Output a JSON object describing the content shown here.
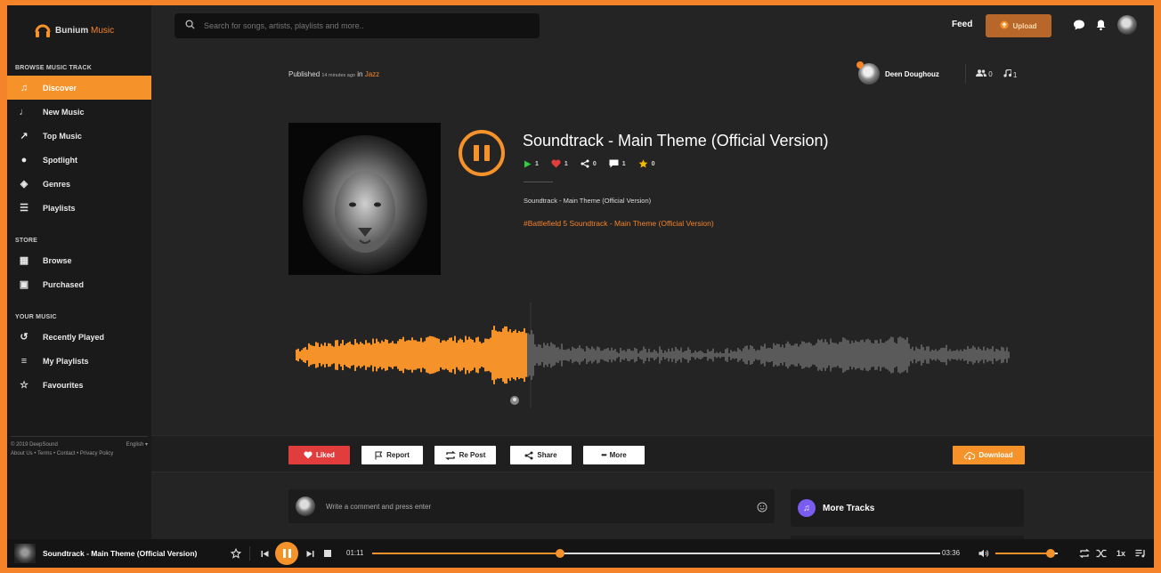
{
  "brand": {
    "name_part1": "Bunium",
    "name_part2": "Music",
    "accent": "#f5932a",
    "frame_color": "#f5832a"
  },
  "header": {
    "search_placeholder": "Search for songs, artists, playlists and more..",
    "feed_label": "Feed",
    "upload_label": "Upload",
    "icons": [
      "chat-icon",
      "bell-icon",
      "user-avatar"
    ]
  },
  "sidebar": {
    "sections": [
      {
        "title": "BROWSE MUSIC TRACK",
        "items": [
          {
            "label": "Discover",
            "icon": "music-notes-icon",
            "active": true
          },
          {
            "label": "New Music",
            "icon": "music-note-icon"
          },
          {
            "label": "Top Music",
            "icon": "chart-line-icon"
          },
          {
            "label": "Spotlight",
            "icon": "drop-icon"
          },
          {
            "label": "Genres",
            "icon": "layers-icon"
          },
          {
            "label": "Playlists",
            "icon": "playlist-icon"
          }
        ]
      },
      {
        "title": "STORE",
        "items": [
          {
            "label": "Browse",
            "icon": "store-icon"
          },
          {
            "label": "Purchased",
            "icon": "bag-icon"
          }
        ]
      },
      {
        "title": "YOUR MUSIC",
        "items": [
          {
            "label": "Recently Played",
            "icon": "history-icon"
          },
          {
            "label": "My Playlists",
            "icon": "my-playlist-icon"
          },
          {
            "label": "Favourites",
            "icon": "star-icon"
          }
        ]
      }
    ],
    "footer": {
      "copyright": "© 2019 DeepSound",
      "language": "English ▾",
      "links": "About Us • Terms • Contact • Privacy Policy"
    }
  },
  "track": {
    "published_prefix": "Published",
    "published_time": "14 minutes ago",
    "published_in": "in",
    "genre": "Jazz",
    "owner_name": "Deen Doughouz",
    "owner_followers": "0",
    "owner_tracks": "1",
    "title": "Soundtrack - Main Theme (Official Version)",
    "stats": {
      "plays": "1",
      "likes": "1",
      "shares": "0",
      "comments": "1",
      "rating": "0"
    },
    "description": "Soundtrack - Main Theme (Official Version)",
    "tags": "#Battlefield 5 Soundtrack - Main Theme (Official Version)",
    "waveform_progress": 0.33
  },
  "actions": {
    "liked": "Liked",
    "report": "Report",
    "repost": "Re Post",
    "share": "Share",
    "more": "More",
    "download": "Download"
  },
  "comments": {
    "placeholder": "Write a comment and press enter",
    "more_tracks": "More Tracks"
  },
  "player": {
    "title": "Soundtrack - Main Theme (Official Version)",
    "current_time": "01:11",
    "total_time": "03:36",
    "progress": 0.33,
    "volume": 0.88,
    "speed": "1x"
  }
}
